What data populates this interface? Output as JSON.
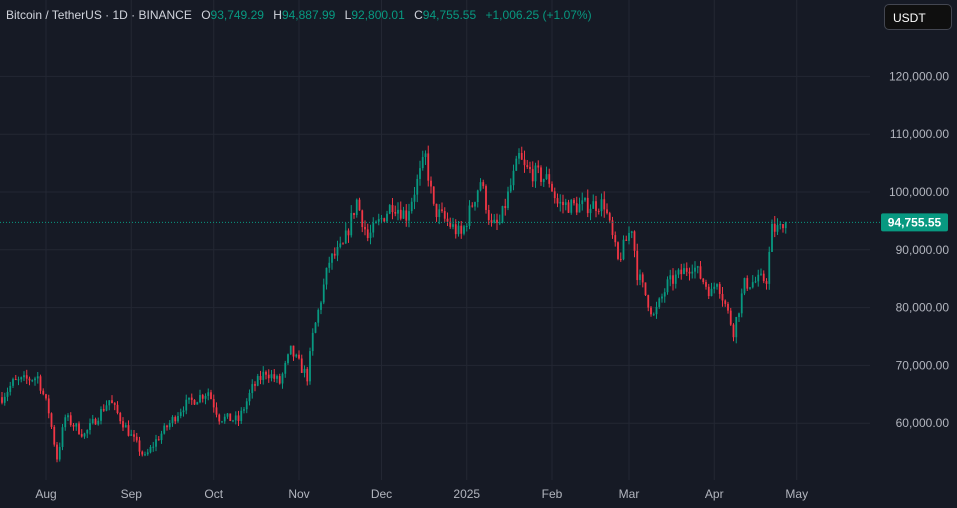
{
  "header": {
    "symbol": "Bitcoin / TetherUS · 1D · BINANCE",
    "open_label": "O",
    "open": "93,749.29",
    "high_label": "H",
    "high": "94,887.99",
    "low_label": "L",
    "low": "92,800.01",
    "close_label": "C",
    "close": "94,755.55",
    "change": "+1,006.25 (+1.07%)"
  },
  "currency_button": "USDT",
  "last_price_label": "94,755.55",
  "colors": {
    "up": "#089981",
    "down": "#f23645",
    "background": "#161a25",
    "grid": "#232733"
  },
  "chart_data": {
    "type": "candlestick",
    "title": "Bitcoin / TetherUS · 1D · BINANCE",
    "ylim": [
      51000,
      128000
    ],
    "y_ticks": [
      {
        "value": 60000,
        "label": "60,000.00"
      },
      {
        "value": 70000,
        "label": "70,000.00"
      },
      {
        "value": 80000,
        "label": "80,000.00"
      },
      {
        "value": 90000,
        "label": "90,000.00"
      },
      {
        "value": 100000,
        "label": "100,000.00"
      },
      {
        "value": 110000,
        "label": "110,000.00"
      },
      {
        "value": 120000,
        "label": "120,000.00"
      }
    ],
    "x_ticks": [
      {
        "date": "2024-08-01",
        "label": "Aug"
      },
      {
        "date": "2024-09-01",
        "label": "Sep"
      },
      {
        "date": "2024-10-01",
        "label": "Oct"
      },
      {
        "date": "2024-11-01",
        "label": "Nov"
      },
      {
        "date": "2024-12-01",
        "label": "Dec"
      },
      {
        "date": "2025-01-01",
        "label": "2025"
      },
      {
        "date": "2025-02-01",
        "label": "Feb"
      },
      {
        "date": "2025-03-01",
        "label": "Mar"
      },
      {
        "date": "2025-04-01",
        "label": "Apr"
      },
      {
        "date": "2025-05-01",
        "label": "May"
      }
    ],
    "last_price": 94755.55,
    "last_candle": {
      "open": 93749.29,
      "high": 94887.99,
      "low": 92800.01,
      "close": 94755.55
    },
    "approx_closes": [
      [
        "2024-07-16",
        64500
      ],
      [
        "2024-07-20",
        67000
      ],
      [
        "2024-07-29",
        68000
      ],
      [
        "2024-08-02",
        62000
      ],
      [
        "2024-08-05",
        54000
      ],
      [
        "2024-08-08",
        61000
      ],
      [
        "2024-08-15",
        58000
      ],
      [
        "2024-08-24",
        64000
      ],
      [
        "2024-08-31",
        58500
      ],
      [
        "2024-09-06",
        54000
      ],
      [
        "2024-09-10",
        57000
      ],
      [
        "2024-09-20",
        63000
      ],
      [
        "2024-09-29",
        65500
      ],
      [
        "2024-10-03",
        61000
      ],
      [
        "2024-10-10",
        60500
      ],
      [
        "2024-10-15",
        66000
      ],
      [
        "2024-10-20",
        69000
      ],
      [
        "2024-10-25",
        67000
      ],
      [
        "2024-10-29",
        72500
      ],
      [
        "2024-11-04",
        68000
      ],
      [
        "2024-11-06",
        75000
      ],
      [
        "2024-11-12",
        88000
      ],
      [
        "2024-11-17",
        90500
      ],
      [
        "2024-11-22",
        98500
      ],
      [
        "2024-11-26",
        92000
      ],
      [
        "2024-12-05",
        98000
      ],
      [
        "2024-12-10",
        96000
      ],
      [
        "2024-12-17",
        106000
      ],
      [
        "2024-12-20",
        97000
      ],
      [
        "2024-12-30",
        92500
      ],
      [
        "2025-01-06",
        102000
      ],
      [
        "2025-01-10",
        94000
      ],
      [
        "2025-01-13",
        94500
      ],
      [
        "2025-01-20",
        106000
      ],
      [
        "2025-01-22",
        104000
      ],
      [
        "2025-01-31",
        102000
      ],
      [
        "2025-02-03",
        98000
      ],
      [
        "2025-02-10",
        97500
      ],
      [
        "2025-02-20",
        98000
      ],
      [
        "2025-02-25",
        88000
      ],
      [
        "2025-03-02",
        94000
      ],
      [
        "2025-03-04",
        86000
      ],
      [
        "2025-03-10",
        78500
      ],
      [
        "2025-03-15",
        84000
      ],
      [
        "2025-03-24",
        87500
      ],
      [
        "2025-03-31",
        82500
      ],
      [
        "2025-04-02",
        85000
      ],
      [
        "2025-04-08",
        76000
      ],
      [
        "2025-04-12",
        84000
      ],
      [
        "2025-04-20",
        85000
      ],
      [
        "2025-04-22",
        93500
      ],
      [
        "2025-04-26",
        93749.29
      ]
    ]
  }
}
